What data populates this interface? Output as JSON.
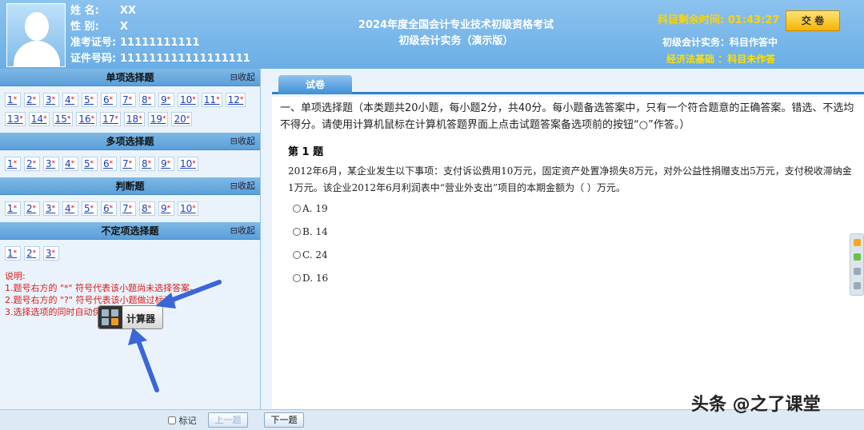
{
  "candidate": {
    "name_label": "姓    名:",
    "name": "XX",
    "gender_label": "性    别:",
    "gender": "X",
    "ticket_label": "准考证号:",
    "ticket": "11111111111",
    "id_label": "证件号码:",
    "id_number": "111111111111111111"
  },
  "exam": {
    "title": "2024年度全国会计专业技术初级资格考试",
    "subtitle": "初级会计实务（演示版）"
  },
  "timer": {
    "label": "科目剩余时间:",
    "value": "01:43:27"
  },
  "submit_label": "交 卷",
  "subjects": [
    {
      "name": "初级会计实务",
      "status": "：科目作答中"
    },
    {
      "name": "经济法基础",
      "status": "：科目未作答"
    }
  ],
  "sections": [
    {
      "title": "单项选择题",
      "collapse": "⊟收起",
      "items": [
        "1",
        "2",
        "3",
        "4",
        "5",
        "6",
        "7",
        "8",
        "9",
        "10",
        "11",
        "12",
        "13",
        "14",
        "15",
        "16",
        "17",
        "18",
        "19",
        "20"
      ]
    },
    {
      "title": "多项选择题",
      "collapse": "⊟收起",
      "items": [
        "1",
        "2",
        "3",
        "4",
        "5",
        "6",
        "7",
        "8",
        "9",
        "10"
      ]
    },
    {
      "title": "判断题",
      "collapse": "⊟收起",
      "items": [
        "1",
        "2",
        "3",
        "4",
        "5",
        "6",
        "7",
        "8",
        "9",
        "10"
      ]
    },
    {
      "title": "不定项选择题",
      "collapse": "⊟收起",
      "items": [
        "1",
        "2",
        "3"
      ]
    }
  ],
  "notes": {
    "title": "说明:",
    "lines": [
      "1.题号右方的 \"*\" 符号代表该小题尚未选择答案。",
      "2.题号右方的 \"?\" 符号代表该小题做过标记。",
      "3.选择选项的同时自动保存答案。"
    ]
  },
  "calculator_label": "计算器",
  "tab_label": "试卷",
  "instructions": "一、单项选择题（本类题共20小题，每小题2分，共40分。每小题备选答案中，只有一个符合题意的正确答案。错选、不选均不得分。请使用计算机鼠标在计算机答题界面上点击试题答案备选项前的按钮“○”作答。）",
  "question": {
    "number": "第 1 题",
    "stem": "2012年6月，某企业发生以下事项：支付诉讼费用10万元，固定资产处置净损失8万元，对外公益性捐赠支出5万元，支付税收滞纳金1万元。该企业2012年6月利润表中“营业外支出”项目的本期金额为（          ）万元。",
    "options": [
      {
        "key": "A.",
        "value": "19"
      },
      {
        "key": "B.",
        "value": "14"
      },
      {
        "key": "C.",
        "value": "24"
      },
      {
        "key": "D.",
        "value": "16"
      }
    ]
  },
  "bottom": {
    "mark": "标记",
    "prev": "上一题",
    "next": "下一题"
  },
  "watermark": "头条 @之了课堂"
}
